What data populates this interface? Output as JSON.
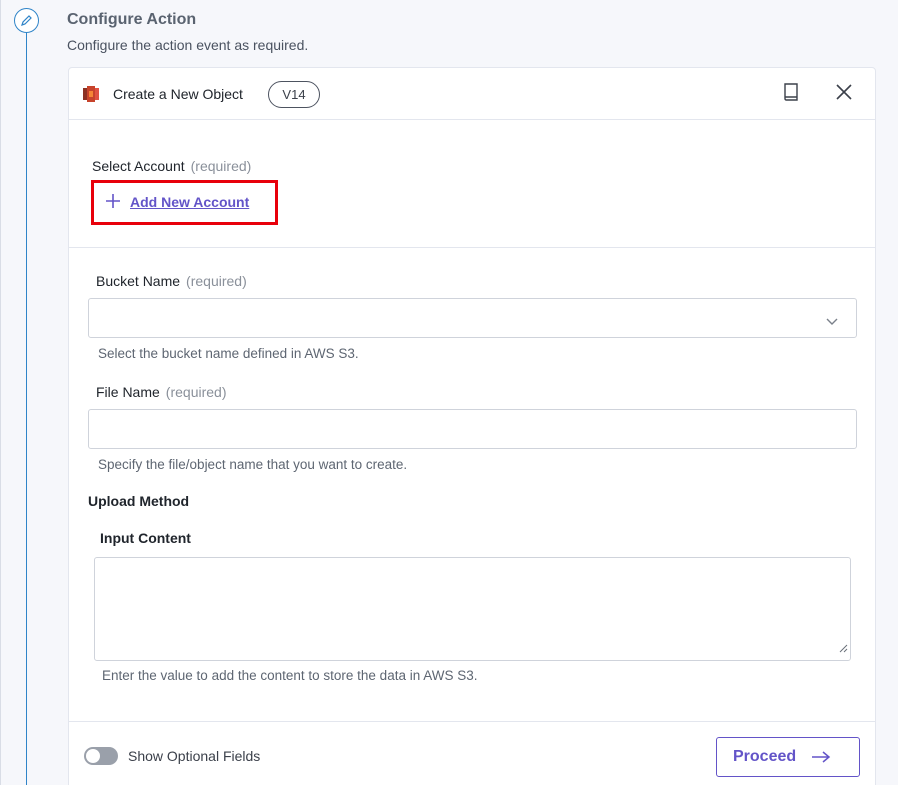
{
  "step": {
    "title": "Configure Action",
    "subtitle": "Configure the action event as required.",
    "icon": "pencil-icon"
  },
  "card": {
    "app_icon": "aws-s3-icon",
    "title": "Create a New Object",
    "version": "V14",
    "doc_icon": "book-icon",
    "close_icon": "close-icon"
  },
  "account": {
    "label": "Select Account",
    "required": "(required)",
    "add_label": "Add New Account"
  },
  "bucket": {
    "label": "Bucket Name",
    "required": "(required)",
    "value": "",
    "help": "Select the bucket name defined in AWS S3."
  },
  "file": {
    "label": "File Name",
    "required": "(required)",
    "value": "",
    "help": "Specify the file/object name that you want to create."
  },
  "upload": {
    "section_label": "Upload Method",
    "input_label": "Input Content",
    "value": "",
    "help": "Enter the value to add the content to store the data in AWS S3."
  },
  "footer": {
    "toggle_label": "Show Optional Fields",
    "toggle_on": false,
    "proceed_label": "Proceed"
  },
  "colors": {
    "accent": "#6354c8",
    "highlight": "#e8000b",
    "timeline": "#2f84c8"
  }
}
